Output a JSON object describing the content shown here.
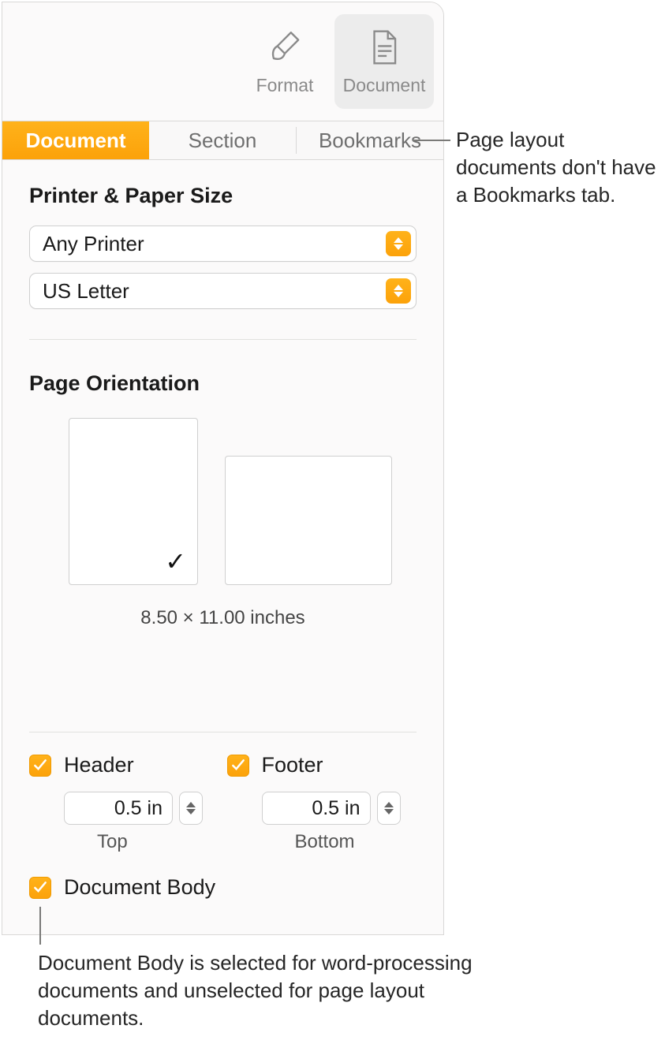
{
  "toolbar": {
    "format_label": "Format",
    "document_label": "Document"
  },
  "tabs": {
    "document": "Document",
    "section": "Section",
    "bookmarks": "Bookmarks"
  },
  "printer_paper": {
    "heading": "Printer & Paper Size",
    "printer": "Any Printer",
    "paper": "US Letter"
  },
  "orientation": {
    "heading": "Page Orientation",
    "dims": "8.50 × 11.00 inches"
  },
  "hf": {
    "header": "Header",
    "footer": "Footer",
    "header_val": "0.5 in",
    "footer_val": "0.5 in",
    "top": "Top",
    "bottom": "Bottom"
  },
  "docbody": {
    "label": "Document Body"
  },
  "callouts": {
    "top": "Page layout documents don't have a Bookmarks tab.",
    "bottom": "Document Body is selected for word-processing documents and unselected for page layout documents."
  }
}
